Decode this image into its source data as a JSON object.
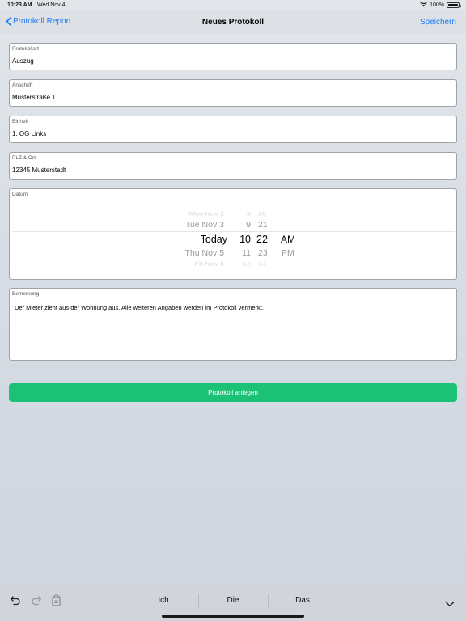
{
  "status_bar": {
    "time": "10:23 AM",
    "date": "Wed Nov 4",
    "battery": "100%",
    "battery_level": 1.0
  },
  "nav": {
    "back_label": "Protokoll Report",
    "title": "Neues Protokoll",
    "save_label": "Speichern"
  },
  "fields": {
    "protokollart": {
      "label": "Protokollart",
      "value": "Auszug"
    },
    "anschrift": {
      "label": "Anschrift",
      "value": "Musterstraße 1"
    },
    "einheit": {
      "label": "Einheit",
      "value": "1. OG Links"
    },
    "plz_ort": {
      "label": "PLZ & Ort",
      "value": "12345 Musterstadt"
    }
  },
  "datum": {
    "label": "Datum",
    "days": [
      "Mon Nov 2",
      "Tue Nov 3",
      "Today",
      "Thu Nov 5",
      "Fri Nov 6"
    ],
    "hours": [
      "8",
      "9",
      "10",
      "11",
      "12"
    ],
    "minutes": [
      "20",
      "21",
      "22",
      "23",
      "24"
    ],
    "ampm": [
      "AM",
      "PM"
    ],
    "selected": {
      "day": "Today",
      "hour": "10",
      "minute": "22",
      "ampm": "AM"
    }
  },
  "bemerkung": {
    "label": "Bemerkung",
    "value": "Der Mieter zieht aus der Wohnung aus. Alle weiteren Angaben werden im Protokoll vermerkt."
  },
  "submit_label": "Protokoll anlegen",
  "keyboard": {
    "suggestions": [
      "Ich",
      "Die",
      "Das"
    ],
    "icons": [
      "undo-icon",
      "redo-icon",
      "paste-icon",
      "dismiss-keyboard-icon"
    ]
  },
  "colors": {
    "accent": "#1b7cf2",
    "button": "#1bc276"
  }
}
